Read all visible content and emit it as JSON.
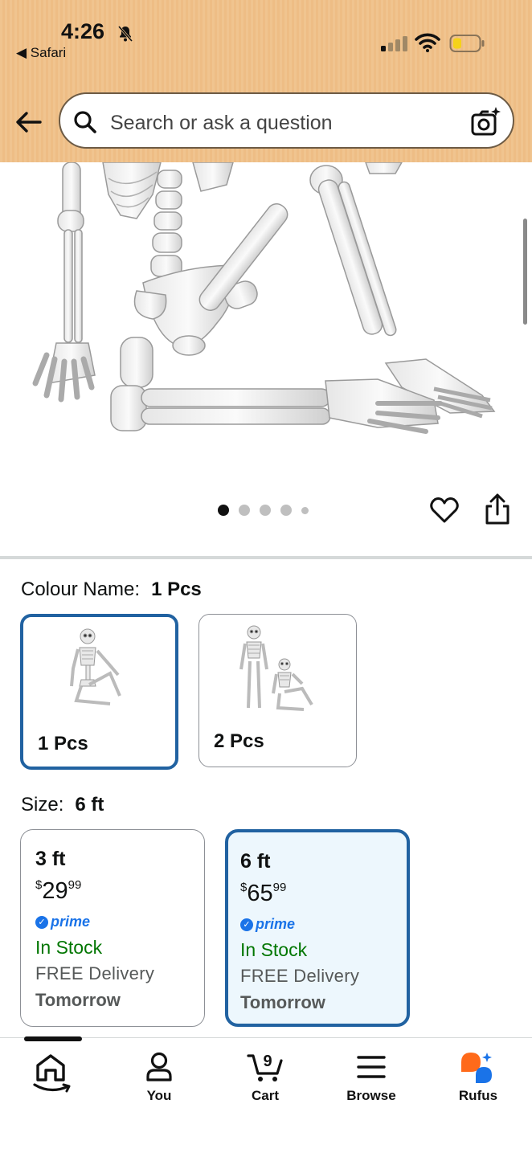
{
  "status_bar": {
    "time": "4:26",
    "back_app": "Safari"
  },
  "search": {
    "placeholder": "Search or ask a question"
  },
  "carousel": {
    "total_images": 5,
    "active_index": 0
  },
  "colour": {
    "label": "Colour Name:",
    "selected": "1 Pcs",
    "options": [
      {
        "label": "1 Pcs",
        "selected": true
      },
      {
        "label": "2 Pcs",
        "selected": false
      }
    ]
  },
  "size": {
    "label": "Size:",
    "selected": "6 ft",
    "options": [
      {
        "label": "3 ft",
        "currency": "$",
        "price_whole": "29",
        "price_fraction": "99",
        "prime": "prime",
        "stock": "In Stock",
        "delivery": "FREE Delivery",
        "delivery_day": "Tomorrow",
        "selected": false
      },
      {
        "label": "6 ft",
        "currency": "$",
        "price_whole": "65",
        "price_fraction": "99",
        "prime": "prime",
        "stock": "In Stock",
        "delivery": "FREE Delivery",
        "delivery_day": "Tomorrow",
        "selected": true
      }
    ]
  },
  "bottom_nav": {
    "items": [
      {
        "label": "",
        "icon": "home-icon"
      },
      {
        "label": "You",
        "icon": "user-icon"
      },
      {
        "label": "Cart",
        "icon": "cart-icon",
        "badge": "9"
      },
      {
        "label": "Browse",
        "icon": "menu-icon"
      },
      {
        "label": "Rufus",
        "icon": "rufus-icon"
      }
    ]
  },
  "colors": {
    "accent": "#2162a1",
    "header": "#f0c48f",
    "stock_green": "#007600",
    "prime_blue": "#1a73e8",
    "rufus_orange": "#ff6a1a"
  }
}
